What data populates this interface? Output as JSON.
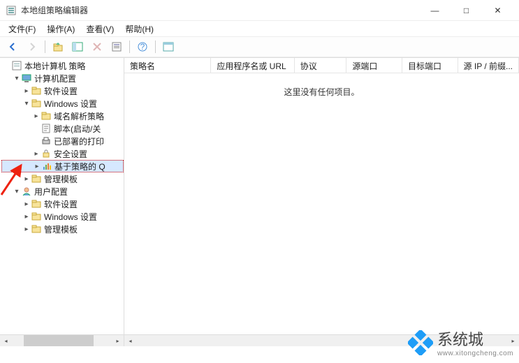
{
  "window": {
    "title": "本地组策略编辑器",
    "minimize": "—",
    "maximize": "□",
    "close": "✕"
  },
  "menu": {
    "file": "文件(F)",
    "action": "操作(A)",
    "view": "查看(V)",
    "help": "帮助(H)"
  },
  "tree": {
    "root": "本地计算机 策略",
    "computer_config": "计算机配置",
    "software_settings": "软件设置",
    "windows_settings": "Windows 设置",
    "dns_policy": "域名解析策略",
    "scripts": "脚本(启动/关",
    "deployed_printers": "已部署的打印",
    "security_settings": "安全设置",
    "policy_based_qos": "基于策略的 Q",
    "admin_templates": "管理模板",
    "user_config": "用户配置",
    "user_software_settings": "软件设置",
    "user_windows_settings": "Windows 设置",
    "user_admin_templates": "管理模板"
  },
  "columns": {
    "policy_name": "策略名",
    "app_or_url": "应用程序名或 URL",
    "protocol": "协议",
    "source_port": "源端口",
    "dest_port": "目标端口",
    "source_ip": "源 IP / 前缀..."
  },
  "list": {
    "empty": "这里没有任何项目。"
  },
  "watermark": {
    "brand": "系统城",
    "url": "www.xitongcheng.com"
  }
}
